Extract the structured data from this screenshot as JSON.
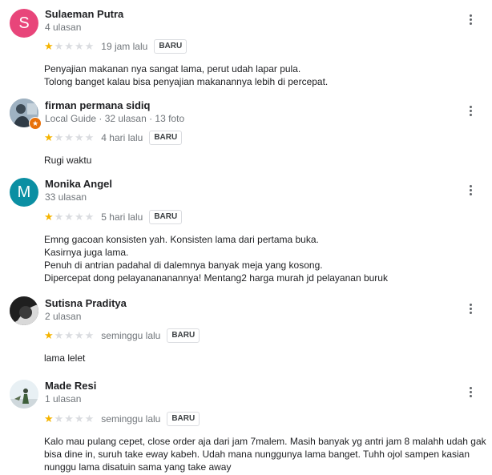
{
  "reviews": [
    {
      "name": "Sulaeman Putra",
      "meta": "4 ulasan",
      "avatar_letter": "S",
      "avatar_color": "#e8457a",
      "rating": 1,
      "time": "19 jam lalu",
      "badge": "BARU",
      "text": [
        "Penyajian makanan nya sangat lama, perut udah lapar pula.",
        "Tolong banget kalau bisa penyajian makanannya lebih di percepat."
      ]
    },
    {
      "name": "firman permana sidiq",
      "meta": "Local Guide · 32 ulasan · 13 foto",
      "avatar_icon": "profile-photo",
      "guide_badge_icon": "star-badge-icon",
      "guide_badge_color": "#e8710a",
      "rating": 1,
      "time": "4 hari lalu",
      "badge": "BARU",
      "text": [
        "Rugi waktu"
      ]
    },
    {
      "name": "Monika Angel",
      "meta": "33 ulasan",
      "avatar_letter": "M",
      "avatar_color": "#0b8fa3",
      "rating": 1,
      "time": "5 hari lalu",
      "badge": "BARU",
      "text": [
        "Emng gacoan konsisten yah. Konsisten lama dari pertama buka.",
        "Kasirnya juga lama.",
        "Penuh di antrian padahal di dalemnya banyak meja yang kosong.",
        "Dipercepat dong pelayanananannya! Mentang2 harga murah jd pelayanan buruk"
      ]
    },
    {
      "name": "Sutisna Praditya",
      "meta": "2 ulasan",
      "avatar_icon": "profile-photo",
      "rating": 1,
      "time": "seminggu lalu",
      "badge": "BARU",
      "text": [
        "lama lelet"
      ]
    },
    {
      "name": "Made Resi",
      "meta": "1 ulasan",
      "avatar_icon": "profile-photo",
      "rating": 1,
      "time": "seminggu lalu",
      "badge": "BARU",
      "text": [
        "Kalo mau pulang cepet, close order aja dari jam 7malem. Masih banyak yg antri jam 8 malahh udah gak",
        "bisa dine in, suruh take eway kabeh. Udah mana nunggunya lama banget. Tuhh ojol sampen kasian",
        "nunggu lama disatuin sama yang take away"
      ]
    }
  ],
  "colors": {
    "star_on": "#f5b400",
    "star_off": "#dadce0"
  }
}
